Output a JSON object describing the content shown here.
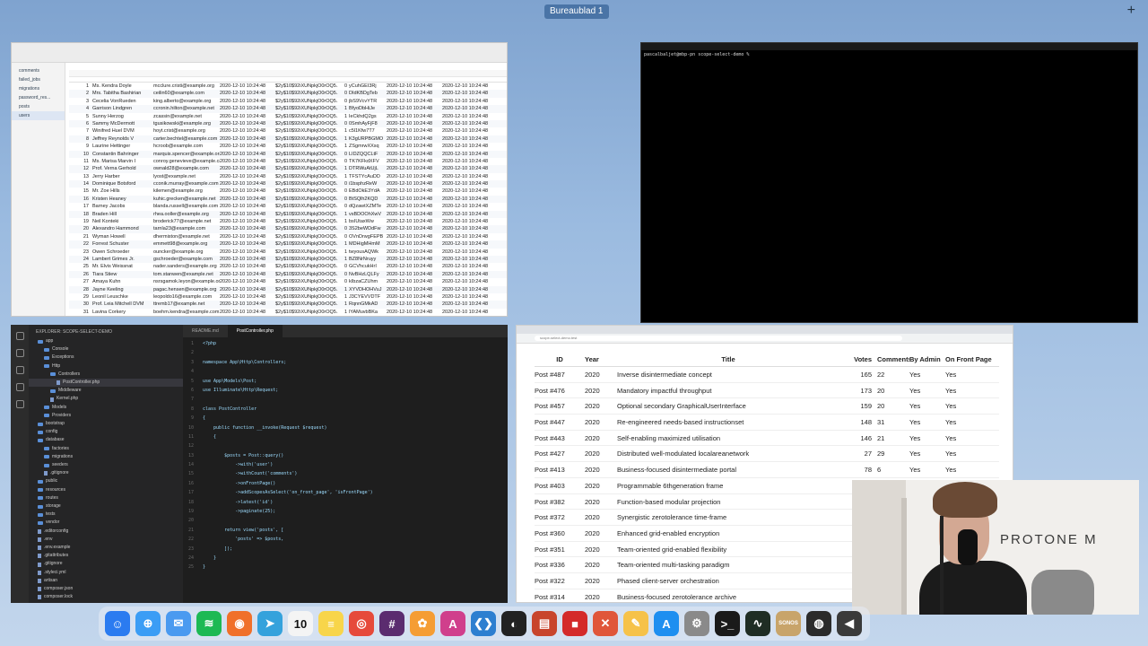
{
  "desktop": {
    "space_label": "Bureaublad 1",
    "add_space": "+"
  },
  "db_window": {
    "tables": [
      "comments",
      "failed_jobs",
      "migrations",
      "password_res...",
      "posts",
      "users"
    ],
    "rows": [
      [
        "1",
        "Ms. Kendra Doyle",
        "mcclure.cristi@example.org",
        "2020-12-10 10:24:48",
        "$2y$10$92iXUNpkjO0rOQ5...",
        "0",
        "yCuhGEI3Rj",
        "2020-12-10 10:24:48",
        "2020-12-10 10:24:48"
      ],
      [
        "2",
        "Mrs. Tabitha Bashirian",
        "ceilin60@example.com",
        "2020-12-10 10:24:48",
        "$2y$10$92iXUNpkjO0rOQ5...",
        "0",
        "DIdKBDgTeb",
        "2020-12-10 10:24:48",
        "2020-12-10 10:24:48"
      ],
      [
        "3",
        "Cecelia VonRueden",
        "king.alberto@example.org",
        "2020-12-10 10:24:48",
        "$2y$10$92iXUNpkjO0rOQ5...",
        "0",
        "jbS9VcvYTR",
        "2020-12-10 10:24:48",
        "2020-12-10 10:24:48"
      ],
      [
        "4",
        "Garrison Lindgren",
        "ccronin.hilton@example.net",
        "2020-12-10 10:24:48",
        "$2y$10$92iXUNpkjO0rOQ5...",
        "1",
        "BfyoDbHiJe",
        "2020-12-10 10:24:48",
        "2020-12-10 10:24:48"
      ],
      [
        "5",
        "Sunny Herzog",
        "zcassin@example.net",
        "2020-12-10 10:24:48",
        "$2y$10$92iXUNpkjO0rOQ5...",
        "1",
        "IeCkhdQ2gs",
        "2020-12-10 10:24:48",
        "2020-12-10 10:24:48"
      ],
      [
        "6",
        "Sammy McDermott",
        "tgusikowski@example.org",
        "2020-12-10 10:24:48",
        "$2y$10$92iXUNpkjO0rOQ5...",
        "0",
        "0SmhAyFjF8",
        "2020-12-10 10:24:48",
        "2020-12-10 10:24:48"
      ],
      [
        "7",
        "Winifred Huel DVM",
        "hoyt.crist@example.org",
        "2020-12-10 10:24:48",
        "$2y$10$92iXUNpkjO0rOQ5...",
        "1",
        "c5l1Kfw7T7",
        "2020-12-10 10:24:48",
        "2020-12-10 10:24:48"
      ],
      [
        "8",
        "Jeffrey Reynolds V",
        "carter.bechtel@example.com",
        "2020-12-10 10:24:48",
        "$2y$10$92iXUNpkjO0rOQ5...",
        "1",
        "K3gURPBGMO",
        "2020-12-10 10:24:48",
        "2020-12-10 10:24:48"
      ],
      [
        "9",
        "Laurine Hettinger",
        "hcroob@example.com",
        "2020-12-10 10:24:48",
        "$2y$10$92iXUNpkjO0rOQ5...",
        "1",
        "ZSgmrwXXsq",
        "2020-12-10 10:24:48",
        "2020-12-10 10:24:48"
      ],
      [
        "10",
        "Constantin Bahringer",
        "marquis.spencer@example.org",
        "2020-12-10 10:24:48",
        "$2y$10$92iXUNpkjO0rOQ5...",
        "0",
        "LIDZQQCLtF",
        "2020-12-10 10:24:48",
        "2020-12-10 10:24:48"
      ],
      [
        "11",
        "Ms. Marisa Marvin I",
        "conroy.genevieve@example.com",
        "2020-12-10 10:24:48",
        "$2y$10$92iXUNpkjO0rOQ5...",
        "0",
        "TK7KFkdXFV",
        "2020-12-10 10:24:48",
        "2020-12-10 10:24:48"
      ],
      [
        "12",
        "Prof. Verna Gerhold",
        "ownald28@example.com",
        "2020-12-10 10:24:48",
        "$2y$10$92iXUNpkjO0rOQ5...",
        "1",
        "DTRWuAtUjL",
        "2020-12-10 10:24:48",
        "2020-12-10 10:24:48"
      ],
      [
        "13",
        "Jerry Harber",
        "lyost@example.net",
        "2020-12-10 10:24:48",
        "$2y$10$92iXUNpkjO0rOQ5...",
        "1",
        "TFSTYcAuDD",
        "2020-12-10 10:24:48",
        "2020-12-10 10:24:48"
      ],
      [
        "14",
        "Dominique Botsford",
        "cconik.murray@example.com",
        "2020-12-10 10:24:48",
        "$2y$10$92iXUNpkjO0rOQ5...",
        "0",
        "i1bsphzReW",
        "2020-12-10 10:24:48",
        "2020-12-10 10:24:48"
      ],
      [
        "15",
        "Mr. Zoe Hills",
        "kilemen@example.org",
        "2020-12-10 10:24:48",
        "$2y$10$92iXUNpkjO0rOQ5...",
        "0",
        "EBdOkE3YdA",
        "2020-12-10 10:24:48",
        "2020-12-10 10:24:48"
      ],
      [
        "16",
        "Kristen Heaney",
        "kuhic.grecken@example.net",
        "2020-12-10 10:24:48",
        "$2y$10$92iXUNpkjO0rOQ5...",
        "0",
        "BtSQlh2KQD",
        "2020-12-10 10:24:48",
        "2020-12-10 10:24:48"
      ],
      [
        "17",
        "Barney Jacobs",
        "blanda.russell@example.com",
        "2020-12-10 10:24:48",
        "$2y$10$92iXUNpkjO0rOQ5...",
        "0",
        "dQzawtXZMTe",
        "2020-12-10 10:24:48",
        "2020-12-10 10:24:48"
      ],
      [
        "18",
        "Braden Hill",
        "rhea.ooller@example.org",
        "2020-12-10 10:24:48",
        "$2y$10$92iXUNpkjO0rOQ5...",
        "1",
        "vsBDOOhXwV",
        "2020-12-10 10:24:48",
        "2020-12-10 10:24:48"
      ],
      [
        "19",
        "Neil Konteki",
        "broderick77@example.net",
        "2020-12-10 10:24:48",
        "$2y$10$92iXUNpkjO0rOQ5...",
        "1",
        "bsIUtaxWw",
        "2020-12-10 10:24:48",
        "2020-12-10 10:24:48"
      ],
      [
        "20",
        "Alexandro Hammond",
        "tarnla23@example.com",
        "2020-12-10 10:24:48",
        "$2y$10$92iXUNpkjO0rOQ5...",
        "0",
        "3S2beWDdFw",
        "2020-12-10 10:24:48",
        "2020-12-10 10:24:48"
      ],
      [
        "21",
        "Wyman Howell",
        "dhermiston@example.net",
        "2020-12-10 10:24:48",
        "$2y$10$92iXUNpkjO0rOQ5...",
        "0",
        "OVnDrwgFEPB",
        "2020-12-10 10:24:48",
        "2020-12-10 10:24:48"
      ],
      [
        "22",
        "Forrest Schuster",
        "emmett98@example.org",
        "2020-12-10 10:24:48",
        "$2y$10$92iXUNpkjO0rOQ5...",
        "1",
        "MDHigMHmM",
        "2020-12-10 10:24:48",
        "2020-12-10 10:24:48"
      ],
      [
        "23",
        "Owen Schroeder",
        "ouncker@example.org",
        "2020-12-10 10:24:48",
        "$2y$10$92iXUNpkjO0rOQ5...",
        "1",
        "twyousAQWk",
        "2020-12-10 10:24:48",
        "2020-12-10 10:24:48"
      ],
      [
        "24",
        "Lambert Grimes Jr.",
        "gschroeder@example.com",
        "2020-12-10 10:24:48",
        "$2y$10$92iXUNpkjO0rOQ5...",
        "1",
        "BZ8NrNruyy",
        "2020-12-10 10:24:48",
        "2020-12-10 10:24:48"
      ],
      [
        "25",
        "Mr. Elvis Weissnat",
        "nader.sanders@example.org",
        "2020-12-10 10:24:48",
        "$2y$10$92iXUNpkjO0rOQ5...",
        "0",
        "GCVhcukHrI",
        "2020-12-10 10:24:48",
        "2020-12-10 10:24:48"
      ],
      [
        "26",
        "Tiara Stiew",
        "tom.stanwen@example.net",
        "2020-12-10 10:24:48",
        "$2y$10$92iXUNpkjO0rOQ5...",
        "0",
        "NvBHzLQLFy",
        "2020-12-10 10:24:48",
        "2020-12-10 10:24:48"
      ],
      [
        "27",
        "Amaya Kuhn",
        "nsrsgamok.leyon@example.org",
        "2020-12-10 10:24:48",
        "$2y$10$92iXUNpkjO0rOQ5...",
        "0",
        "kIbzaCZUhm",
        "2020-12-10 10:24:48",
        "2020-12-10 10:24:48"
      ],
      [
        "28",
        "Jayne Keeling",
        "pagac.hensen@example.org",
        "2020-12-10 10:24:48",
        "$2y$10$92iXUNpkjO0rOQ5...",
        "1",
        "XYVDHOHVuJ",
        "2020-12-10 10:24:48",
        "2020-12-10 10:24:48"
      ],
      [
        "29",
        "Leonil Leuschke",
        "leopoldo16@example.com",
        "2020-12-10 10:24:48",
        "$2y$10$92iXUNpkjO0rOQ5...",
        "1",
        "J3CYEVVDTF",
        "2020-12-10 10:24:48",
        "2020-12-10 10:24:48"
      ],
      [
        "30",
        "Prof. Leia Mitchell DVM",
        "ttremb17@example.net",
        "2020-12-10 10:24:48",
        "$2y$10$92iXUNpkjO0rOQ5...",
        "1",
        "RqnnGMkAD",
        "2020-12-10 10:24:48",
        "2020-12-10 10:24:48"
      ],
      [
        "31",
        "Lavina Corkery",
        "boehm.kendra@example.com",
        "2020-12-10 10:24:48",
        "$2y$10$92iXUNpkjO0rOQ5...",
        "1",
        "lYAMuvbBKa",
        "2020-12-10 10:24:48",
        "2020-12-10 10:24:48"
      ]
    ]
  },
  "terminal": {
    "line": "pascalbaljet@mbp-pn scope-select-demo %"
  },
  "editor": {
    "explorer_title": "EXPLORER: SCOPE-SELECT-DEMO",
    "tree": [
      {
        "label": "app",
        "type": "folder",
        "depth": 0
      },
      {
        "label": "Console",
        "type": "folder",
        "depth": 1
      },
      {
        "label": "Exceptions",
        "type": "folder",
        "depth": 1
      },
      {
        "label": "Http",
        "type": "folder",
        "depth": 1
      },
      {
        "label": "Controllers",
        "type": "folder",
        "depth": 2
      },
      {
        "label": "PostController.php",
        "type": "file",
        "depth": 3,
        "selected": true
      },
      {
        "label": "Middleware",
        "type": "folder",
        "depth": 2
      },
      {
        "label": "Kernel.php",
        "type": "file",
        "depth": 2
      },
      {
        "label": "Models",
        "type": "folder",
        "depth": 1
      },
      {
        "label": "Providers",
        "type": "folder",
        "depth": 1
      },
      {
        "label": "bootstrap",
        "type": "folder",
        "depth": 0
      },
      {
        "label": "config",
        "type": "folder",
        "depth": 0
      },
      {
        "label": "database",
        "type": "folder",
        "depth": 0
      },
      {
        "label": "factories",
        "type": "folder",
        "depth": 1
      },
      {
        "label": "migrations",
        "type": "folder",
        "depth": 1
      },
      {
        "label": "seeders",
        "type": "folder",
        "depth": 1
      },
      {
        "label": ".gitignore",
        "type": "file",
        "depth": 1
      },
      {
        "label": "public",
        "type": "folder",
        "depth": 0
      },
      {
        "label": "resources",
        "type": "folder",
        "depth": 0
      },
      {
        "label": "routes",
        "type": "folder",
        "depth": 0
      },
      {
        "label": "storage",
        "type": "folder",
        "depth": 0
      },
      {
        "label": "tests",
        "type": "folder",
        "depth": 0
      },
      {
        "label": "vendor",
        "type": "folder",
        "depth": 0
      },
      {
        "label": ".editorconfig",
        "type": "file",
        "depth": 0
      },
      {
        "label": ".env",
        "type": "file",
        "depth": 0
      },
      {
        "label": ".env.example",
        "type": "file",
        "depth": 0
      },
      {
        "label": ".gitattributes",
        "type": "file",
        "depth": 0
      },
      {
        "label": ".gitignore",
        "type": "file",
        "depth": 0
      },
      {
        "label": ".styleci.yml",
        "type": "file",
        "depth": 0
      },
      {
        "label": "artisan",
        "type": "file",
        "depth": 0
      },
      {
        "label": "composer.json",
        "type": "file",
        "depth": 0
      },
      {
        "label": "composer.lock",
        "type": "file",
        "depth": 0
      }
    ],
    "tabs": [
      "README.md",
      "PostController.php"
    ],
    "code": [
      [
        "1",
        "<?php"
      ],
      [
        "2",
        ""
      ],
      [
        "3",
        "namespace App\\Http\\Controllers;"
      ],
      [
        "4",
        ""
      ],
      [
        "5",
        "use App\\Models\\Post;"
      ],
      [
        "6",
        "use Illuminate\\Http\\Request;"
      ],
      [
        "7",
        ""
      ],
      [
        "8",
        "class PostController"
      ],
      [
        "9",
        "{"
      ],
      [
        "10",
        "    public function __invoke(Request $request)"
      ],
      [
        "11",
        "    {"
      ],
      [
        "12",
        ""
      ],
      [
        "13",
        "        $posts = Post::query()"
      ],
      [
        "14",
        "            ->with('user')"
      ],
      [
        "15",
        "            ->withCount('comments')"
      ],
      [
        "16",
        "            ->onFrontPage()"
      ],
      [
        "17",
        "            ->addScopesAsSelect('on_front_page', 'isFrontPage')"
      ],
      [
        "18",
        "            ->latest('id')"
      ],
      [
        "19",
        "            ->paginate(25);"
      ],
      [
        "20",
        ""
      ],
      [
        "21",
        "        return view('posts', ["
      ],
      [
        "22",
        "            'posts' => $posts,"
      ],
      [
        "23",
        "        ]);"
      ],
      [
        "24",
        "    }"
      ],
      [
        "25",
        "}"
      ]
    ]
  },
  "browser": {
    "url": "scope-select-demo.test",
    "columns": [
      "ID",
      "Year",
      "Title",
      "Votes",
      "Comments",
      "By Admin",
      "On Front Page"
    ],
    "rows": [
      [
        "Post #487",
        "2020",
        "Inverse disintermediate concept",
        "165",
        "22",
        "Yes",
        "Yes"
      ],
      [
        "Post #476",
        "2020",
        "Mandatory impactful throughput",
        "173",
        "20",
        "Yes",
        "Yes"
      ],
      [
        "Post #457",
        "2020",
        "Optional secondary GraphicalUserInterface",
        "159",
        "20",
        "Yes",
        "Yes"
      ],
      [
        "Post #447",
        "2020",
        "Re-engineered needs-based instructionset",
        "148",
        "31",
        "Yes",
        "Yes"
      ],
      [
        "Post #443",
        "2020",
        "Self-enabling maximized utilisation",
        "146",
        "21",
        "Yes",
        "Yes"
      ],
      [
        "Post #427",
        "2020",
        "Distributed well-modulated localareanetwork",
        "27",
        "29",
        "Yes",
        "Yes"
      ],
      [
        "Post #413",
        "2020",
        "Business-focused disintermediate portal",
        "78",
        "6",
        "Yes",
        "Yes"
      ],
      [
        "Post #403",
        "2020",
        "Programmable 6thgeneration frame",
        "187",
        "",
        "",
        ""
      ],
      [
        "Post #382",
        "2020",
        "Function-based modular projection",
        "",
        "",
        "",
        ""
      ],
      [
        "Post #372",
        "2020",
        "Synergistic zerotolerance time-frame",
        "95",
        "",
        "",
        ""
      ],
      [
        "Post #360",
        "2020",
        "Enhanced grid-enabled encryption",
        "",
        "",
        "",
        ""
      ],
      [
        "Post #351",
        "2020",
        "Team-oriented grid-enabled flexibility",
        "30",
        "",
        "",
        ""
      ],
      [
        "Post #336",
        "2020",
        "Team-oriented multi-tasking paradigm",
        "",
        "",
        "",
        ""
      ],
      [
        "Post #322",
        "2020",
        "Phased client-server orchestration",
        "",
        "",
        "",
        ""
      ],
      [
        "Post #314",
        "2020",
        "Business-focused zerotolerance archive",
        "68",
        "",
        "",
        ""
      ]
    ]
  },
  "webcam": {
    "logo": "PROTONE M"
  },
  "dock": {
    "items": [
      {
        "name": "finder-icon",
        "color": "#2b7bf0",
        "glyph": "☺"
      },
      {
        "name": "safari-icon",
        "color": "#3b9df5",
        "glyph": "⊕"
      },
      {
        "name": "mail-icon",
        "color": "#4a9af0",
        "glyph": "✉"
      },
      {
        "name": "spotify-icon",
        "color": "#1db954",
        "glyph": "≋"
      },
      {
        "name": "firefox-icon",
        "color": "#f0702a",
        "glyph": "◉"
      },
      {
        "name": "telegram-icon",
        "color": "#35a2dc",
        "glyph": "➤"
      },
      {
        "name": "calendar-icon",
        "color": "#f4f4f4",
        "glyph": "10",
        "text": "#111"
      },
      {
        "name": "notes-icon",
        "color": "#f8d54a",
        "glyph": "≡"
      },
      {
        "name": "chrome-icon",
        "color": "#e64a3b",
        "glyph": "◎"
      },
      {
        "name": "slack-icon",
        "color": "#5b2c6f",
        "glyph": "#"
      },
      {
        "name": "photos-icon",
        "color": "#f59d34",
        "glyph": "✿"
      },
      {
        "name": "affinity-icon",
        "color": "#d03f8c",
        "glyph": "A"
      },
      {
        "name": "vscode-icon",
        "color": "#2d7fd0",
        "glyph": "❮❯"
      },
      {
        "name": "github-icon",
        "color": "#222222",
        "glyph": "◐"
      },
      {
        "name": "tableplus-icon",
        "color": "#c8452c",
        "glyph": "▤"
      },
      {
        "name": "box-icon",
        "color": "#d42a2a",
        "glyph": "■"
      },
      {
        "name": "tool-icon",
        "color": "#e0563a",
        "glyph": "✕"
      },
      {
        "name": "pencil-icon",
        "color": "#f6c249",
        "glyph": "✎"
      },
      {
        "name": "appstore-icon",
        "color": "#1e8ff0",
        "glyph": "A"
      },
      {
        "name": "settings-icon",
        "color": "#8a8a8a",
        "glyph": "⚙"
      },
      {
        "name": "terminal-icon",
        "color": "#1a1a1a",
        "glyph": ">_"
      },
      {
        "name": "activity-icon",
        "color": "#1f2d24",
        "glyph": "∿"
      },
      {
        "name": "sonos-icon",
        "color": "#c8a46a",
        "glyph": "SONOS"
      },
      {
        "name": "obs-icon",
        "color": "#2b2b2b",
        "glyph": "◍"
      },
      {
        "name": "misc-icon",
        "color": "#3a3a3a",
        "glyph": "◀"
      }
    ]
  }
}
